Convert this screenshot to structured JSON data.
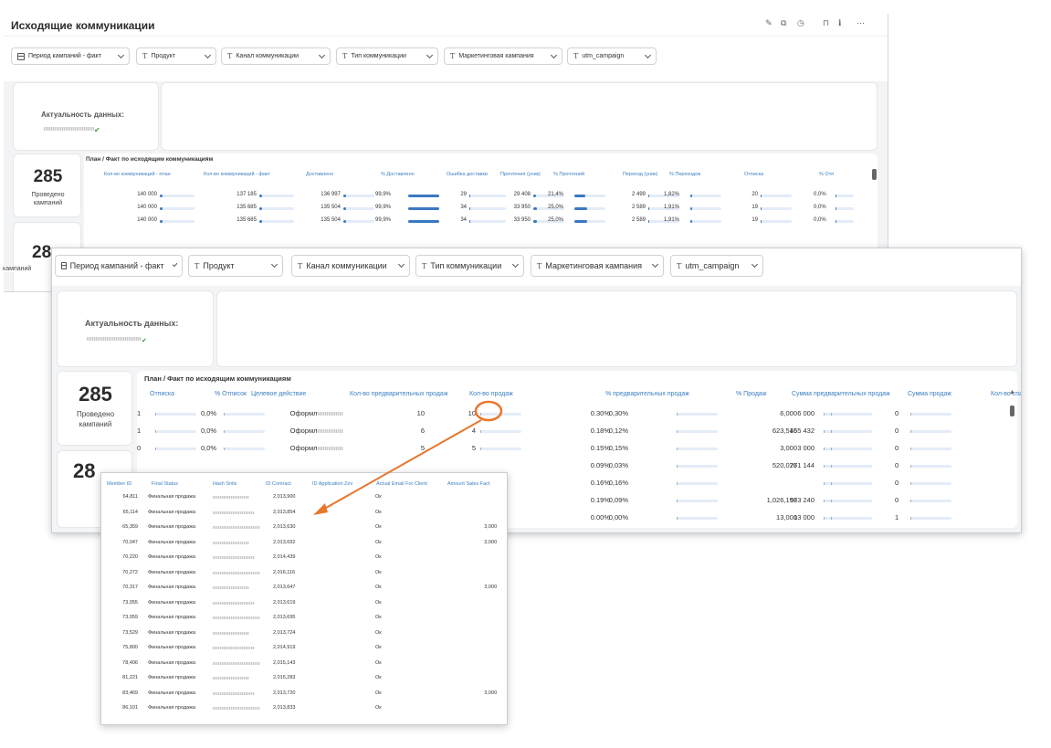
{
  "window1": {
    "title": "Исходящие коммуникации",
    "toolbar_icons": [
      "edit-icon",
      "share-icon",
      "history-icon",
      "bookmark-icon",
      "info-icon",
      "more-icon"
    ],
    "filters": [
      {
        "label": "Период кампаний - факт",
        "type": "date"
      },
      {
        "label": "Продукт",
        "type": "text"
      },
      {
        "label": "Канал коммуникации",
        "type": "text"
      },
      {
        "label": "Тип коммуникации",
        "type": "text"
      },
      {
        "label": "Маркетинговая кампания",
        "type": "text"
      },
      {
        "label": "utm_campaign",
        "type": "text"
      }
    ],
    "freshness_label": "Актуальность данных:",
    "kpi_value": "285",
    "kpi_label_1": "Проведено",
    "kpi_label_2": "кампаний",
    "kpi2_value_partial": "28",
    "kpi2_label_partial": "кампаний",
    "table_title": "План / Факт по исходящим коммуникациям",
    "columns": [
      "Кол-во коммуникаций - план",
      "Кол-во коммуникаций - факт",
      "Доставлено",
      "% Доставлено",
      "Ошибка доставки",
      "Прочтения (уник)",
      "% Прочтений",
      "Переход (уник)",
      "% Переходов",
      "Отписка",
      "% Отп"
    ],
    "rows": [
      [
        "140 000",
        "137 185",
        "136 997",
        "99,9%",
        "29",
        "29 408",
        "21,4%",
        "2 499",
        "1,82%",
        "20",
        "0,0%"
      ],
      [
        "140 000",
        "135 685",
        "135 504",
        "99,9%",
        "34",
        "33 950",
        "25,0%",
        "2 589",
        "1,91%",
        "19",
        "0,0%"
      ],
      [
        "140 000",
        "135 685",
        "135 504",
        "99,9%",
        "34",
        "33 950",
        "25,0%",
        "2 589",
        "1,91%",
        "19",
        "0,0%"
      ]
    ],
    "row_fill": [
      [
        0.08,
        0.08,
        0.08,
        1.0,
        0,
        0.1,
        0.35,
        0.04,
        0.05,
        0,
        0
      ],
      [
        0.08,
        0.08,
        0.08,
        1.0,
        0,
        0.12,
        0.4,
        0.04,
        0.05,
        0,
        0
      ],
      [
        0.08,
        0.08,
        0.08,
        1.0,
        0,
        0.12,
        0.4,
        0.04,
        0.05,
        0,
        0
      ]
    ]
  },
  "window2": {
    "filters": [
      {
        "label": "Период кампаний - факт",
        "type": "date"
      },
      {
        "label": "Продукт",
        "type": "text"
      },
      {
        "label": "Канал коммуникации",
        "type": "text"
      },
      {
        "label": "Тип коммуникации",
        "type": "text"
      },
      {
        "label": "Маркетинговая кампания",
        "type": "text"
      },
      {
        "label": "utm_campaign",
        "type": "text"
      }
    ],
    "freshness_label": "Актуальность данных:",
    "kpi_value": "285",
    "kpi_label_1": "Проведено",
    "kpi_label_2": "кампаний",
    "kpi2_value_partial": "28",
    "kpi2_label_partial": "кампаний",
    "left_edge_label": "кампаний",
    "table_title": "План / Факт по исходящим коммуникациям",
    "columns": [
      "Отписка",
      "% Отписок",
      "Целевое действие",
      "Кол-во предварительных продаж",
      "Кол-во продаж",
      "% предварительных продаж",
      "% Продаж",
      "Сумма предварительных продаж",
      "Сумма продаж",
      "Кол-во спама"
    ],
    "rows": [
      [
        "1",
        "0,0%",
        "Оформлени",
        "10",
        "10",
        "0.30%",
        "0,30%",
        "6,000",
        "6 000",
        "0"
      ],
      [
        "1",
        "0,0%",
        "Оформлени",
        "6",
        "4",
        "0.18%",
        "0,12%",
        "623,516",
        "455 432",
        "0"
      ],
      [
        "0",
        "0,0%",
        "Оформлени",
        "5",
        "5",
        "0.15%",
        "0,15%",
        "3,000",
        "3 000",
        "0"
      ],
      [
        "",
        "",
        "",
        "",
        "",
        "0.09%",
        "0,03%",
        "520,076",
        "271 144",
        "0"
      ],
      [
        "",
        "",
        "",
        "",
        "",
        "0.16%",
        "0,16%",
        "",
        "",
        "0"
      ],
      [
        "",
        "",
        "",
        "",
        "",
        "0.19%",
        "0,09%",
        "1,026,196",
        "573 240",
        "0"
      ],
      [
        "",
        "",
        "",
        "",
        "",
        "0.00%",
        "0,00%",
        "13,000",
        "13 000",
        "1"
      ]
    ],
    "highlighted_value": "10"
  },
  "detail_table": {
    "columns": [
      "Member ID",
      "Final Status",
      "Hash Snils",
      "ID Contract",
      "ID Application Zev",
      "Actual Email For Client",
      "Amount Sales Fact"
    ],
    "rows": [
      [
        "64,811",
        "Финальная продажа",
        "2,013,900",
        "Ок",
        ""
      ],
      [
        "65,114",
        "Финальная продажа",
        "2,013,854",
        "Ок",
        ""
      ],
      [
        "65,359",
        "Финальная продажа",
        "2,013,630",
        "Ок",
        "3,000"
      ],
      [
        "70,047",
        "Финальная продажа",
        "2,013,692",
        "Ок",
        "3,000"
      ],
      [
        "70,220",
        "Финальная продажа",
        "2,014,439",
        "Ок",
        ""
      ],
      [
        "70,272",
        "Финальная продажа",
        "2,016,116",
        "Ок",
        ""
      ],
      [
        "70,317",
        "Финальная продажа",
        "2,013,647",
        "Ок",
        "3,000"
      ],
      [
        "73,055",
        "Финальная продажа",
        "2,013,619",
        "Ок",
        ""
      ],
      [
        "73,059",
        "Финальная продажа",
        "2,013,695",
        "Ок",
        ""
      ],
      [
        "73,529",
        "Финальная продажа",
        "2,013,724",
        "Ок",
        ""
      ],
      [
        "75,800",
        "Финальная продажа",
        "2,014,919",
        "Ок",
        ""
      ],
      [
        "78,406",
        "Финальная продажа",
        "2,015,143",
        "Ок",
        ""
      ],
      [
        "81,221",
        "Финальная продажа",
        "2,015,283",
        "Ок",
        ""
      ],
      [
        "83,469",
        "Финальная продажа",
        "2,013,720",
        "Ок",
        "3,000"
      ],
      [
        "86,101",
        "Финальная продажа",
        "2,013,833",
        "Ок",
        ""
      ]
    ]
  },
  "colors": {
    "accent": "#3a78c2",
    "header_text": "#3d7fc1",
    "annotation": "#e8772e",
    "check": "#3a9a3a"
  }
}
